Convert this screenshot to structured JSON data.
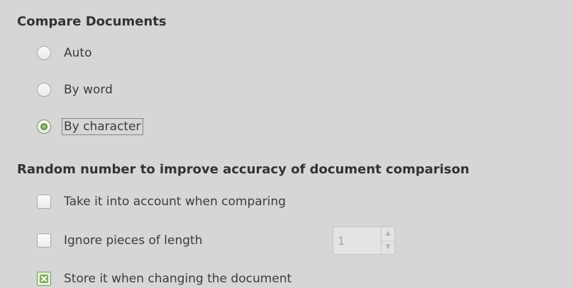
{
  "compare_documents": {
    "title": "Compare Documents",
    "options": [
      {
        "label": "Auto",
        "checked": false
      },
      {
        "label": "By word",
        "checked": false
      },
      {
        "label": "By character",
        "checked": true
      }
    ]
  },
  "random_number": {
    "title": "Random number to improve accuracy of document comparison",
    "take_into_account": {
      "label": "Take it into account when comparing",
      "checked": false
    },
    "ignore_pieces": {
      "label": "Ignore pieces of length",
      "checked": false,
      "value": "1"
    },
    "store_it": {
      "label": "Store it when changing the document",
      "checked": true
    }
  },
  "icons": {
    "spin_up": "triangle-up-icon",
    "spin_down": "triangle-down-icon",
    "check": "x-check-icon"
  },
  "colors": {
    "background": "#d6d6d6",
    "accent_green": "#6b9a4c"
  }
}
